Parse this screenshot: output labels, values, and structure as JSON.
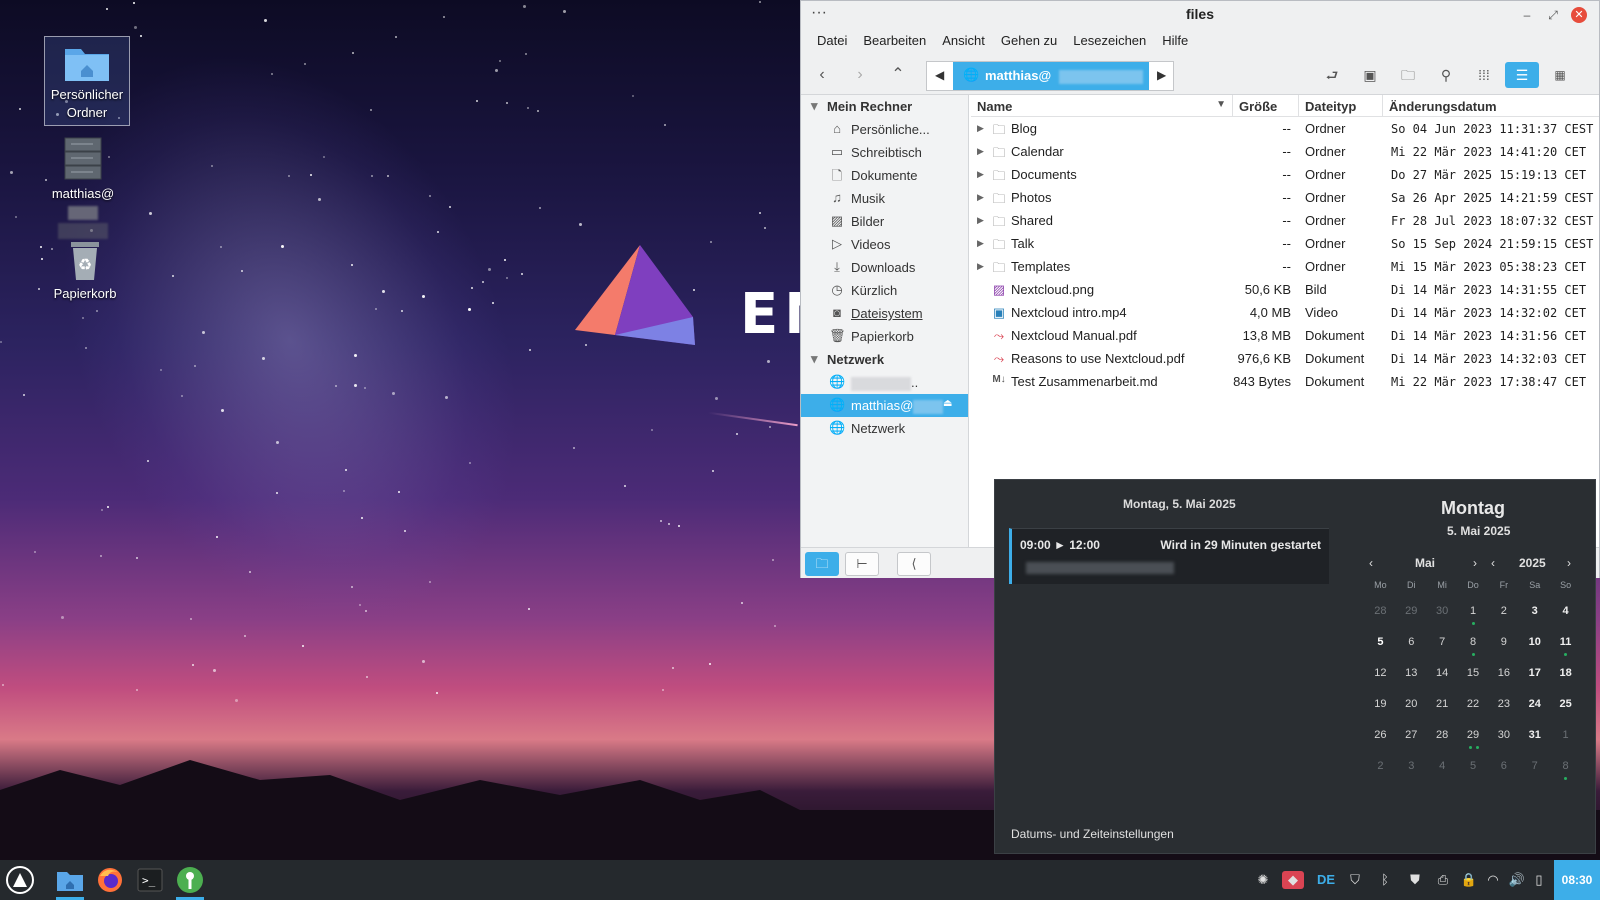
{
  "desktop": {
    "icons": [
      {
        "label": "Persönlicher Ordner",
        "icon": "home-folder-icon"
      },
      {
        "label": "matthias@",
        "icon": "server-icon"
      },
      {
        "label": "Papierkorb",
        "icon": "trash-icon"
      }
    ],
    "wallpaper_text": "ENI"
  },
  "window": {
    "title": "files",
    "menu": [
      "Datei",
      "Bearbeiten",
      "Ansicht",
      "Gehen zu",
      "Lesezeichen",
      "Hilfe"
    ],
    "path_segment": "matthias@",
    "sidebar": {
      "sections": [
        {
          "title": "Mein Rechner",
          "items": [
            {
              "label": "Persönliche...",
              "icon": "home-icon"
            },
            {
              "label": "Schreibtisch",
              "icon": "desktop-icon"
            },
            {
              "label": "Dokumente",
              "icon": "document-icon"
            },
            {
              "label": "Musik",
              "icon": "music-icon"
            },
            {
              "label": "Bilder",
              "icon": "image-icon"
            },
            {
              "label": "Videos",
              "icon": "video-icon"
            },
            {
              "label": "Downloads",
              "icon": "download-icon"
            },
            {
              "label": "Kürzlich",
              "icon": "clock-icon"
            },
            {
              "label": "Dateisystem",
              "icon": "drive-icon"
            },
            {
              "label": "Papierkorb",
              "icon": "trash-icon"
            }
          ]
        },
        {
          "title": "Netzwerk",
          "items": [
            {
              "label": "..",
              "icon": "globe-icon"
            },
            {
              "label": "matthias@",
              "icon": "globe-icon"
            },
            {
              "label": "Netzwerk",
              "icon": "globe-icon"
            }
          ]
        }
      ]
    },
    "columns": [
      "Name",
      "Größe",
      "Dateityp",
      "Änderungsdatum"
    ],
    "files": [
      {
        "name": "Blog",
        "size": "--",
        "type": "Ordner",
        "date": "So 04 Jun 2023 11:31:37 CEST",
        "kind": "folder"
      },
      {
        "name": "Calendar",
        "size": "--",
        "type": "Ordner",
        "date": "Mi 22 Mär 2023 14:41:20 CET",
        "kind": "folder"
      },
      {
        "name": "Documents",
        "size": "--",
        "type": "Ordner",
        "date": "Do 27 Mär 2025 15:19:13 CET",
        "kind": "folder"
      },
      {
        "name": "Photos",
        "size": "--",
        "type": "Ordner",
        "date": "Sa 26 Apr 2025 14:21:59 CEST",
        "kind": "folder"
      },
      {
        "name": "Shared",
        "size": "--",
        "type": "Ordner",
        "date": "Fr 28 Jul 2023 18:07:32 CEST",
        "kind": "folder"
      },
      {
        "name": "Talk",
        "size": "--",
        "type": "Ordner",
        "date": "So 15 Sep 2024 21:59:15 CEST",
        "kind": "folder"
      },
      {
        "name": "Templates",
        "size": "--",
        "type": "Ordner",
        "date": "Mi 15 Mär 2023 05:38:23 CET",
        "kind": "folder"
      },
      {
        "name": "Nextcloud.png",
        "size": "50,6 KB",
        "type": "Bild",
        "date": "Di 14 Mär 2023 14:31:55 CET",
        "kind": "image"
      },
      {
        "name": "Nextcloud intro.mp4",
        "size": "4,0 MB",
        "type": "Video",
        "date": "Di 14 Mär 2023 14:32:02 CET",
        "kind": "video"
      },
      {
        "name": "Nextcloud Manual.pdf",
        "size": "13,8 MB",
        "type": "Dokument",
        "date": "Di 14 Mär 2023 14:31:56 CET",
        "kind": "pdf"
      },
      {
        "name": "Reasons to use Nextcloud.pdf",
        "size": "976,6 KB",
        "type": "Dokument",
        "date": "Di 14 Mär 2023 14:32:03 CET",
        "kind": "pdf"
      },
      {
        "name": "Test Zusammenarbeit.md",
        "size": "843 Bytes",
        "type": "Dokument",
        "date": "Mi 22 Mär 2023 17:38:47 CET",
        "kind": "markdown"
      }
    ]
  },
  "calendar_popup": {
    "agenda_date": "Montag, 5. Mai 2025",
    "event": {
      "start": "09:00",
      "end": "12:00",
      "status": "Wird in 29 Minuten gestartet"
    },
    "settings_link": "Datums- und Zeiteinstellungen",
    "day_name": "Montag",
    "full_date": "5. Mai 2025",
    "month": "Mai",
    "year": "2025",
    "weekdays": [
      "Mo",
      "Di",
      "Mi",
      "Do",
      "Fr",
      "Sa",
      "So"
    ],
    "weeks": [
      [
        [
          "28",
          "o"
        ],
        [
          "29",
          "o"
        ],
        [
          "30",
          "o"
        ],
        [
          "1",
          "e"
        ],
        [
          "2",
          ""
        ],
        [
          "3",
          "w"
        ],
        [
          "4",
          "w"
        ]
      ],
      [
        [
          "5",
          "t"
        ],
        [
          "6",
          ""
        ],
        [
          "7",
          ""
        ],
        [
          "8",
          "e"
        ],
        [
          "9",
          ""
        ],
        [
          "10",
          "w"
        ],
        [
          "11",
          "we"
        ]
      ],
      [
        [
          "12",
          ""
        ],
        [
          "13",
          ""
        ],
        [
          "14",
          ""
        ],
        [
          "15",
          ""
        ],
        [
          "16",
          ""
        ],
        [
          "17",
          "w"
        ],
        [
          "18",
          "w"
        ]
      ],
      [
        [
          "19",
          ""
        ],
        [
          "20",
          ""
        ],
        [
          "21",
          ""
        ],
        [
          "22",
          ""
        ],
        [
          "23",
          ""
        ],
        [
          "24",
          "w"
        ],
        [
          "25",
          "w"
        ]
      ],
      [
        [
          "26",
          ""
        ],
        [
          "27",
          ""
        ],
        [
          "28",
          ""
        ],
        [
          "29",
          "e2"
        ],
        [
          "30",
          ""
        ],
        [
          "31",
          "w"
        ],
        [
          "1",
          "o"
        ]
      ],
      [
        [
          "2",
          "o"
        ],
        [
          "3",
          "o"
        ],
        [
          "4",
          "o"
        ],
        [
          "5",
          "o"
        ],
        [
          "6",
          "o"
        ],
        [
          "7",
          "o"
        ],
        [
          "8",
          "oe"
        ]
      ]
    ]
  },
  "taskbar": {
    "keyboard_layout": "DE",
    "clock": "08:30",
    "accent": "#3daee9"
  }
}
